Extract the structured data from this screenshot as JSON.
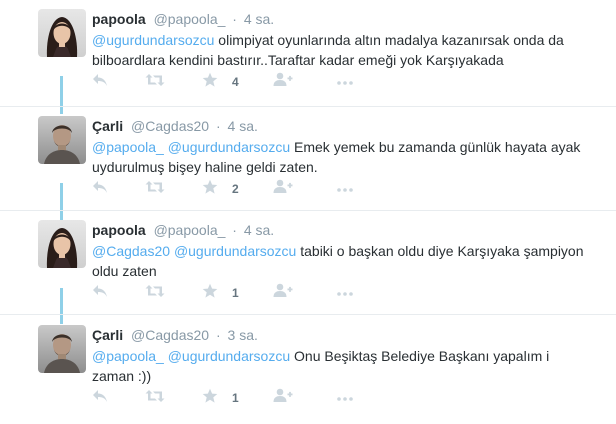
{
  "tweets": [
    {
      "fullname": "papoola",
      "username": "@papoola_",
      "time": "4 sa.",
      "segments": [
        {
          "text": "@ugurdundarsozcu",
          "type": "mention"
        },
        {
          "text": " olimpiyat oyunlarında altın madalya kazanırsak onda da bilboardlara kendini bastırır..Taraftar kadar emeği yok Karşıyakada",
          "type": "text"
        }
      ],
      "favorites": "4",
      "avatar": "female"
    },
    {
      "fullname": "Çarli",
      "username": "@Cagdas20",
      "time": "4 sa.",
      "segments": [
        {
          "text": "@papoola_",
          "type": "mention"
        },
        {
          "text": " ",
          "type": "text"
        },
        {
          "text": "@ugurdundarsozcu",
          "type": "mention"
        },
        {
          "text": " Emek yemek bu zamanda günlük hayata ayak uydurulmuş bişey haline geldi zaten.",
          "type": "text"
        }
      ],
      "favorites": "2",
      "avatar": "male"
    },
    {
      "fullname": "papoola",
      "username": "@papoola_",
      "time": "4 sa.",
      "segments": [
        {
          "text": "@Cagdas20",
          "type": "mention"
        },
        {
          "text": " ",
          "type": "text"
        },
        {
          "text": "@ugurdundarsozcu",
          "type": "mention"
        },
        {
          "text": " tabiki o başkan oldu diye Karşıyaka şampiyon oldu zaten",
          "type": "text"
        }
      ],
      "favorites": "1",
      "avatar": "female"
    },
    {
      "fullname": "Çarli",
      "username": "@Cagdas20",
      "time": "3 sa.",
      "segments": [
        {
          "text": "@papoola_",
          "type": "mention"
        },
        {
          "text": " ",
          "type": "text"
        },
        {
          "text": "@ugurdundarsozcu",
          "type": "mention"
        },
        {
          "text": " Onu Beşiktaş Belediye Başkanı yapalım i zaman :))",
          "type": "text"
        }
      ],
      "favorites": "1",
      "avatar": "male"
    }
  ],
  "icons": {
    "reply": "reply-icon",
    "retweet": "retweet-icon",
    "favorite": "star-icon",
    "follow": "follow-icon",
    "more": "more-icon"
  },
  "colors": {
    "mention": "#55acee",
    "thread_line": "#8fd0e8",
    "action_icon": "#ccd6dd",
    "name": "#292f33",
    "meta": "#8899a6"
  }
}
